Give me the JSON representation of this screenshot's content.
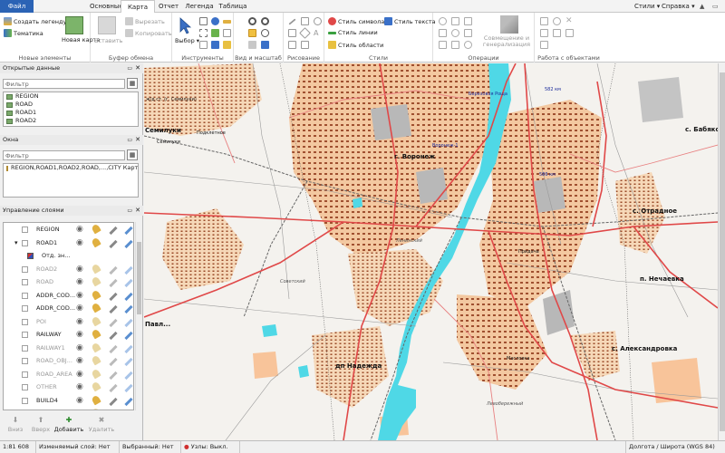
{
  "tabs": {
    "file": "Файл",
    "items": [
      "Основные",
      "Карта",
      "Отчет",
      "Легенда",
      "Таблица"
    ],
    "right": [
      "Стили ▾",
      "Справка ▾"
    ]
  },
  "ribbon": {
    "new": {
      "create_legend": "Создать легенду",
      "thematic": "Тематика",
      "new_map": "Новая карта",
      "label": "Новые элементы"
    },
    "clipboard": {
      "paste": "Вставить",
      "cut": "Вырезать",
      "copy": "Копировать",
      "label": "Буфер обмена"
    },
    "tools": {
      "select": "Выбор",
      "label": "Инструменты"
    },
    "view": {
      "label": "Вид и масштаб"
    },
    "draw": {
      "label": "Рисование"
    },
    "styles": {
      "symbol": "Стиль символа",
      "text": "Стиль текста",
      "line": "Стиль линии",
      "area": "Стиль области",
      "label": "Стили"
    },
    "ops": {
      "combine": "Совмещение и генерализация",
      "label": "Операции"
    },
    "objects": {
      "label": "Работа с объектами"
    }
  },
  "panels": {
    "open_data": {
      "title": "Открытые данные",
      "filter": "Фильтр",
      "items": [
        "REGION",
        "ROAD",
        "ROAD1",
        "ROAD2"
      ]
    },
    "windows": {
      "title": "Окна",
      "filter": "Фильтр",
      "items": [
        "REGION,ROAD1,ROAD2,ROAD,...,CITY Карта"
      ]
    },
    "layers": {
      "title": "Управление слоями",
      "rows": [
        {
          "name": "REGION",
          "dim": false
        },
        {
          "name": "ROAD1",
          "dim": false
        },
        {
          "name": "Отд. зн...",
          "dim": false
        },
        {
          "name": "ROAD2",
          "dim": true
        },
        {
          "name": "ROAD",
          "dim": true
        },
        {
          "name": "ADDR_COD...",
          "dim": false
        },
        {
          "name": "ADDR_COD...",
          "dim": false
        },
        {
          "name": "POI",
          "dim": true
        },
        {
          "name": "RAILWAY",
          "dim": false
        },
        {
          "name": "RAILWAY1",
          "dim": true
        },
        {
          "name": "ROAD_OBJ...",
          "dim": true
        },
        {
          "name": "ROAD_AREA",
          "dim": true
        },
        {
          "name": "OTHER",
          "dim": true
        },
        {
          "name": "BUILD4",
          "dim": false
        },
        {
          "name": "BUILD",
          "dim": true
        }
      ],
      "buttons": [
        "Вниз",
        "Вверх",
        "Добавить",
        "Удалить"
      ]
    }
  },
  "map": {
    "labels": {
      "semiluki_rail": "ж/д ст. (г. Семилуки)",
      "semiluki": "Семилуки",
      "semiluki2": "Семилуки",
      "podkletnoe": "Подклетное",
      "voronezh": "г. Воронеж",
      "voronezh1": "Воронеж-1",
      "berezovaya": "Березовая Роща",
      "km582": "582 км",
      "km586": "586 км",
      "babyakovo": "с. Бабяко",
      "otradnoe": "с. Отрадное",
      "nechaevka": "п. Нечаевка",
      "aleksandrovka": "с. Александровка",
      "nadezhda": "дп Надежда",
      "sovetsky": "Советский",
      "leninsky": "Ленинский",
      "pridacha": "Придача",
      "maslovka": "Масловка",
      "levoberezhny": "Левобережный",
      "pavl": "Павл..."
    }
  },
  "status": {
    "scale": "1:81 608",
    "edit_layer": "Изменяемый слой: Нет",
    "selected_layer": "Выбранный: Нет",
    "nodes": "Узлы: Выкл.",
    "coords": "Долгота / Широта (WGS 84)"
  },
  "colors": {
    "accent": "#2b63b5",
    "water": "#4fd8e6",
    "road_major": "#e04848",
    "urban": "#f3c8a0",
    "industrial": "#b8b8b8"
  }
}
